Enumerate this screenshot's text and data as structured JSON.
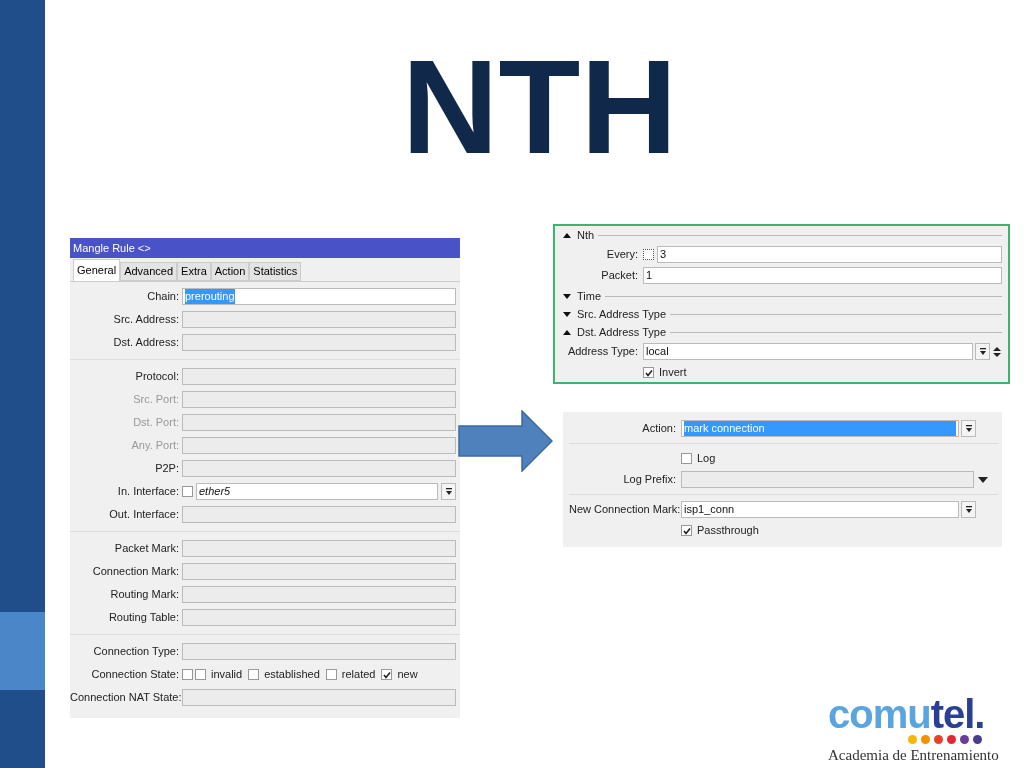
{
  "slide": {
    "title": "NTH"
  },
  "mangle_rule": {
    "title": "Mangle Rule <>",
    "tabs": [
      {
        "label": "General",
        "selected": true
      },
      {
        "label": "Advanced",
        "selected": false
      },
      {
        "label": "Extra",
        "selected": false
      },
      {
        "label": "Action",
        "selected": false
      },
      {
        "label": "Statistics",
        "selected": false
      }
    ],
    "groups": [
      [
        {
          "kind": "field",
          "label": "Chain:",
          "value": "prerouting",
          "highlighted": true,
          "disabled": false
        },
        {
          "kind": "field",
          "label": "Src. Address:",
          "disabled": false
        },
        {
          "kind": "field",
          "label": "Dst. Address:",
          "disabled": false
        }
      ],
      [
        {
          "kind": "field",
          "label": "Protocol:",
          "disabled": false
        },
        {
          "kind": "field",
          "label": "Src. Port:",
          "disabled": true
        },
        {
          "kind": "field",
          "label": "Dst. Port:",
          "disabled": true
        },
        {
          "kind": "field",
          "label": "Any. Port:",
          "disabled": true
        },
        {
          "kind": "field",
          "label": "P2P:",
          "disabled": false
        },
        {
          "kind": "interface",
          "label": "In. Interface:",
          "checked": false,
          "value": "ether5"
        },
        {
          "kind": "field",
          "label": "Out. Interface:",
          "disabled": false
        }
      ],
      [
        {
          "kind": "field",
          "label": "Packet Mark:",
          "disabled": false
        },
        {
          "kind": "field",
          "label": "Connection Mark:",
          "disabled": false
        },
        {
          "kind": "field",
          "label": "Routing Mark:",
          "disabled": false
        },
        {
          "kind": "field",
          "label": "Routing Table:",
          "disabled": false
        }
      ],
      [
        {
          "kind": "field",
          "label": "Connection Type:",
          "disabled": false
        },
        {
          "kind": "states",
          "label": "Connection State:",
          "invert": false,
          "options": [
            {
              "label": "invalid",
              "checked": false
            },
            {
              "label": "established",
              "checked": false
            },
            {
              "label": "related",
              "checked": false
            },
            {
              "label": "new",
              "checked": true
            }
          ]
        },
        {
          "kind": "field",
          "label": "Connection NAT State:",
          "disabled": false
        }
      ]
    ]
  },
  "match_panel": {
    "sections": [
      {
        "label": "Nth",
        "expanded": true,
        "rows": [
          {
            "kind": "field_check",
            "label": "Every:",
            "checked": false,
            "value": "3"
          },
          {
            "kind": "field",
            "label": "Packet:",
            "value": "1"
          }
        ]
      },
      {
        "label": "Time",
        "expanded": false
      },
      {
        "label": "Src. Address Type",
        "expanded": false
      },
      {
        "label": "Dst. Address Type",
        "expanded": true,
        "rows": [
          {
            "kind": "select_spin",
            "label": "Address Type:",
            "value": "local",
            "highlighted": false
          },
          {
            "kind": "check",
            "label": "Invert",
            "checked": true
          }
        ]
      }
    ]
  },
  "action_panel": {
    "groups": [
      [
        {
          "kind": "select",
          "label": "Action:",
          "value": "mark connection",
          "highlighted": true
        }
      ],
      [
        {
          "kind": "check",
          "label": "Log",
          "checked": false
        },
        {
          "kind": "prefix",
          "label": "Log Prefix:"
        }
      ],
      [
        {
          "kind": "select",
          "label": "New Connection Mark:",
          "value": "isp1_conn",
          "highlighted": false
        },
        {
          "kind": "check",
          "label": "Passthrough",
          "checked": true
        }
      ]
    ]
  },
  "logo": {
    "parts": [
      "comu",
      "tel."
    ],
    "subtitle": "Academia de Entrenamiento",
    "dots": [
      {
        "color": "#f5b800"
      },
      {
        "color": "#f39200"
      },
      {
        "color": "#e8402a"
      },
      {
        "color": "#e3262f"
      },
      {
        "color": "#6a3d9a"
      },
      {
        "color": "#4b3c8f"
      }
    ]
  }
}
